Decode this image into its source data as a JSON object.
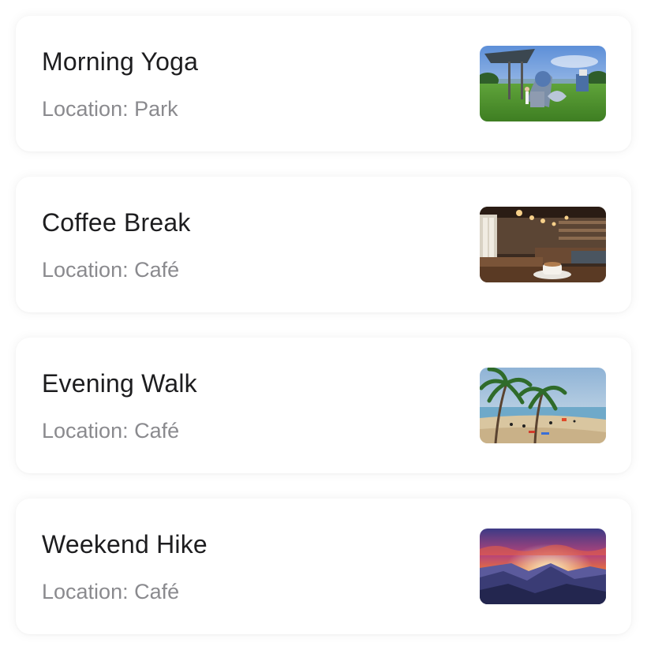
{
  "events": [
    {
      "title": "Morning Yoga",
      "location": "Location: Park",
      "image": "park-playground-photo"
    },
    {
      "title": "Coffee Break",
      "location": "Location: Café",
      "image": "cafe-interior-photo"
    },
    {
      "title": "Evening Walk",
      "location": "Location: Café",
      "image": "tropical-beach-photo"
    },
    {
      "title": "Weekend Hike",
      "location": "Location: Café",
      "image": "mountain-sunset-photo"
    }
  ]
}
